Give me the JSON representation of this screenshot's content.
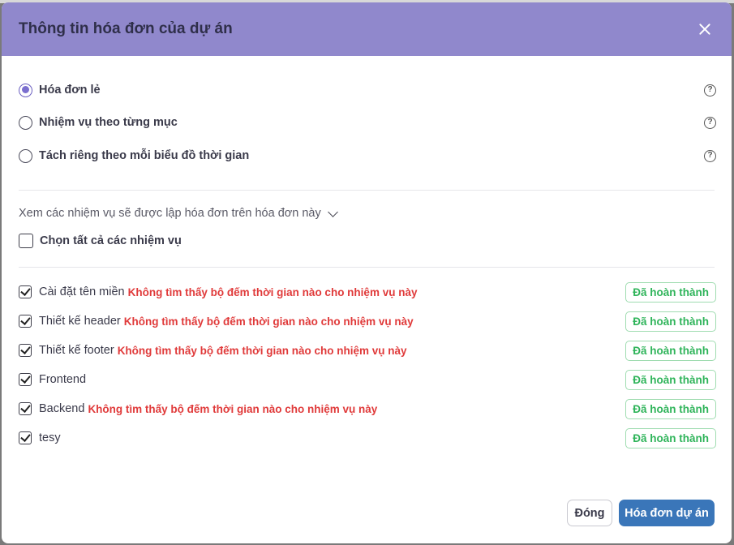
{
  "modal": {
    "title": "Thông tin hóa đơn của dự án"
  },
  "invoice_types": [
    {
      "label": "Hóa đơn lẻ",
      "selected": true
    },
    {
      "label": "Nhiệm vụ theo từng mục",
      "selected": false
    },
    {
      "label": "Tách riêng theo mỗi biểu đồ thời gian",
      "selected": false
    }
  ],
  "help_glyph": "?",
  "tasks_toggle_label": "Xem các nhiệm vụ sẽ được lập hóa đơn trên hóa đơn này",
  "select_all_label": "Chọn tất cả các nhiệm vụ",
  "tasks": [
    {
      "name": "Cài đặt tên miền",
      "warning": "Không tìm thấy bộ đếm thời gian nào cho nhiệm vụ này",
      "status": "Đã hoàn thành",
      "checked": true
    },
    {
      "name": "Thiết kế header",
      "warning": "Không tìm thấy bộ đếm thời gian nào cho nhiệm vụ này",
      "status": "Đã hoàn thành",
      "checked": true
    },
    {
      "name": "Thiết kế footer",
      "warning": "Không tìm thấy bộ đếm thời gian nào cho nhiệm vụ này",
      "status": "Đã hoàn thành",
      "checked": true
    },
    {
      "name": "Frontend",
      "warning": "",
      "status": "Đã hoàn thành",
      "checked": true
    },
    {
      "name": "Backend",
      "warning": "Không tìm thấy bộ đếm thời gian nào cho nhiệm vụ này",
      "status": "Đã hoàn thành",
      "checked": true
    },
    {
      "name": "tesy",
      "warning": "",
      "status": "Đã hoàn thành",
      "checked": true
    }
  ],
  "footer": {
    "close_label": "Đóng",
    "submit_label": "Hóa đơn dự án"
  },
  "colors": {
    "header_bg": "#9088cc",
    "primary": "#3a76b9",
    "warning": "#e03a3a",
    "success": "#2fb45a"
  }
}
